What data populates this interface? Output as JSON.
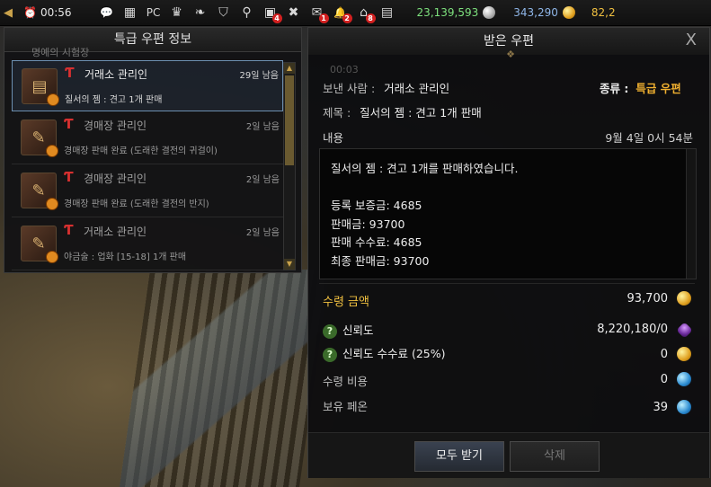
{
  "topbar": {
    "back": "◀",
    "clock": "00:56",
    "icons": [
      {
        "name": "chat-icon",
        "glyph": "💬",
        "badge": ""
      },
      {
        "name": "calendar-icon",
        "glyph": "▦",
        "badge": ""
      },
      {
        "name": "pc-icon",
        "glyph": "PC",
        "badge": ""
      },
      {
        "name": "crown-icon",
        "glyph": "♛",
        "badge": ""
      },
      {
        "name": "feather-icon",
        "glyph": "❧",
        "badge": ""
      },
      {
        "name": "shield-icon",
        "glyph": "⛉",
        "badge": ""
      },
      {
        "name": "whistle-icon",
        "glyph": "⚲",
        "badge": ""
      },
      {
        "name": "box-icon",
        "glyph": "▣",
        "badge": "4"
      },
      {
        "name": "handshake-icon",
        "glyph": "✖",
        "badge": ""
      },
      {
        "name": "mail-icon",
        "glyph": "✉",
        "badge": "1"
      },
      {
        "name": "bell-icon",
        "glyph": "🔔",
        "badge": "2"
      },
      {
        "name": "house-icon",
        "glyph": "⌂",
        "badge": "8"
      },
      {
        "name": "chest-icon",
        "glyph": "▤",
        "badge": ""
      }
    ],
    "silver": "23,139,593",
    "gold": "343,290",
    "gold2": "82,2"
  },
  "left_panel": {
    "title": "특급 우편 정보",
    "ghost_text": "명예의 시험장",
    "mails": [
      {
        "mark": "Ƭ",
        "sender": "거래소 관리인",
        "days": "29일 남음",
        "subject": "질서의 젬 : 견고 1개 판매",
        "icon": "chest"
      },
      {
        "mark": "Ƭ",
        "sender": "경매장 관리인",
        "days": "2일 남음",
        "subject": "경매장 판매 완료 (도래한 결전의 귀걸이)",
        "icon": "scroll"
      },
      {
        "mark": "Ƭ",
        "sender": "경매장 관리인",
        "days": "2일 남음",
        "subject": "경매장 판매 완료 (도래한 결전의 반지)",
        "icon": "scroll"
      },
      {
        "mark": "Ƭ",
        "sender": "거래소 관리인",
        "days": "2일 남음",
        "subject": "야금술 : 업화 [15-18] 1개 판매",
        "icon": "scroll"
      }
    ]
  },
  "right_panel": {
    "title": "받은 우편",
    "close": "X",
    "ghost": "00:03",
    "sender_label": "보낸 사람 :",
    "sender": "거래소 관리인",
    "type_label": "종류 :",
    "type": "특급 우편",
    "subject_label": "제목 :",
    "subject": "질서의 젬 : 견고 1개 판매",
    "content_label": "내용",
    "date": "9월 4일 0시 54분",
    "content_lines": [
      "질서의 젬 : 견고 1개를 판매하였습니다.",
      "",
      "등록 보증금: 4685",
      "판매금: 93700",
      "판매 수수료: 4685",
      "최종 판매금: 93700"
    ],
    "receive_amount_label": "수령 금액",
    "receive_amount": "93,700",
    "trust_label": "신뢰도",
    "trust_value": "8,220,180/0",
    "trust_fee_label": "신뢰도 수수료 (25%)",
    "trust_fee": "0",
    "receive_cost_label": "수령 비용",
    "receive_cost": "0",
    "pheon_label": "보유 페온",
    "pheon": "39",
    "receive_all_button": "모두 받기",
    "delete_button": "삭제"
  }
}
